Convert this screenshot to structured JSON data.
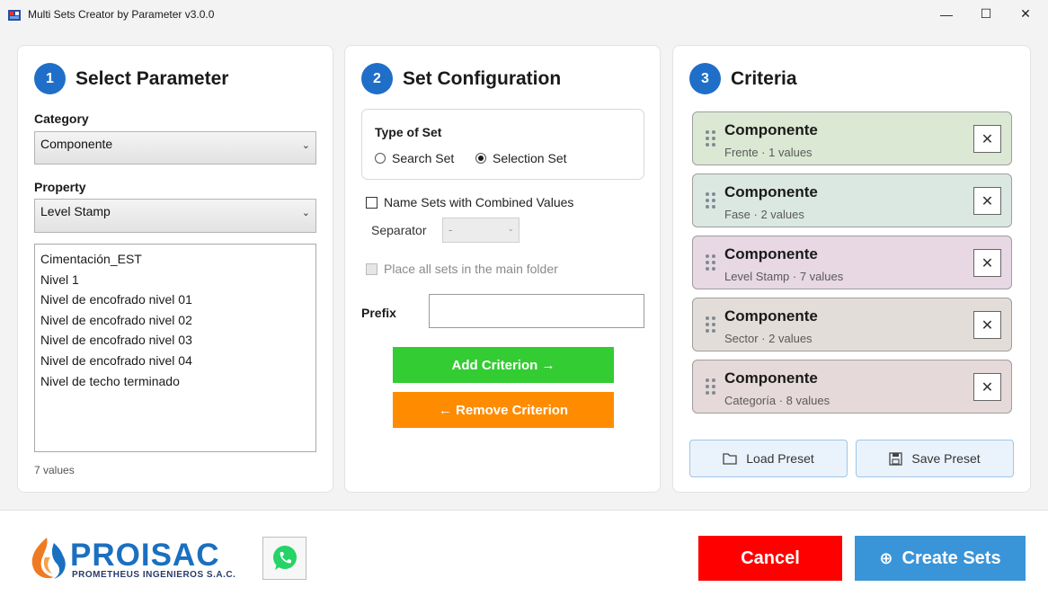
{
  "window": {
    "title": "Multi Sets Creator by Parameter v3.0.0",
    "min_glyph": "—",
    "max_glyph": "☐",
    "close_glyph": "✕"
  },
  "panel1": {
    "step": "1",
    "title": "Select Parameter",
    "category_label": "Category",
    "category_value": "Componente",
    "property_label": "Property",
    "property_value": "Level Stamp",
    "values": [
      "Cimentación_EST",
      "Nivel 1",
      "Nivel de encofrado nivel 01",
      "Nivel de encofrado nivel 02",
      "Nivel de encofrado nivel 03",
      "Nivel de encofrado nivel 04",
      "Nivel de techo terminado"
    ],
    "count_text": "7 values"
  },
  "panel2": {
    "step": "2",
    "title": "Set Configuration",
    "type_label": "Type of Set",
    "search_set": "Search Set",
    "selection_set": "Selection Set",
    "selected_type": "selection",
    "combined_label": "Name Sets with Combined Values",
    "combined_checked": false,
    "separator_label": "Separator",
    "separator_value": "-",
    "main_folder_label": "Place all sets in the main folder",
    "prefix_label": "Prefix",
    "prefix_value": "",
    "add_label": "Add Criterion  →",
    "remove_label": "←  Remove Criterion"
  },
  "panel3": {
    "step": "3",
    "title": "Criteria",
    "criteria": [
      {
        "name": "Componente",
        "meta": "Frente  ·  1  values",
        "color": "#dbe8d3"
      },
      {
        "name": "Componente",
        "meta": "Fase  ·  2  values",
        "color": "#dbe8e2"
      },
      {
        "name": "Componente",
        "meta": "Level Stamp  ·  7  values",
        "color": "#e7d8e4"
      },
      {
        "name": "Componente",
        "meta": "Sector  ·  2  values",
        "color": "#e3ddda"
      },
      {
        "name": "Componente",
        "meta": "Categoría  ·  8  values",
        "color": "#e6d9d9"
      }
    ],
    "remove_glyph": "✕",
    "load_preset": "Load Preset",
    "save_preset": "Save Preset"
  },
  "footer": {
    "logo_name": "PROISAC",
    "logo_sub": "PROMETHEUS INGENIEROS S.A.C.",
    "cancel_label": "Cancel",
    "create_label": "Create Sets",
    "create_glyph": "⊕"
  },
  "colors": {
    "accent": "#1f6fc9",
    "add": "#33cc33",
    "remove": "#ff8c00",
    "cancel": "#ff0000",
    "create": "#3a94d8"
  }
}
